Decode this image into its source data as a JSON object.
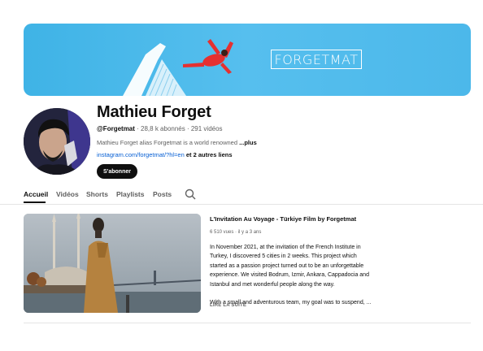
{
  "banner": {
    "logo_text": "FORGETMAT",
    "bg_color": "#4cb8ea"
  },
  "channel": {
    "name": "Mathieu Forget",
    "handle": "@Forgetmat",
    "stats": " · 28,8 k abonnés · 291 vidéos",
    "description": "Mathieu Forget alias Forgetmat is a world renowned ",
    "description_more": "...plus",
    "link": "instagram.com/forgetmat/?hl=en",
    "other_links": " et 2 autres liens",
    "subscribe_label": "S'abonner"
  },
  "tabs": [
    {
      "label": "Accueil",
      "active": true
    },
    {
      "label": "Vidéos",
      "active": false
    },
    {
      "label": "Shorts",
      "active": false
    },
    {
      "label": "Playlists",
      "active": false
    },
    {
      "label": "Posts",
      "active": false
    }
  ],
  "featured_video": {
    "title": "L'Invitation Au Voyage - Türkiye Film by Forgetmat",
    "views": "6 510 vues",
    "age": "il y a 3 ans",
    "description_lines": [
      "In November 2021, at the invitation of the French Institute in",
      "Turkey, I discovered 5 cities in 2 weeks. This project which",
      "started as a passion project turned out to be an unforgettable",
      "experience. We visited Bodrum, Izmir, Ankara, Cappadocia and",
      "Istanbul and met wonderful people along the way."
    ],
    "description_line_final": "With a small and adventurous team, my goal was to suspend, ...",
    "read_more": "LIRE LA SUITE"
  }
}
